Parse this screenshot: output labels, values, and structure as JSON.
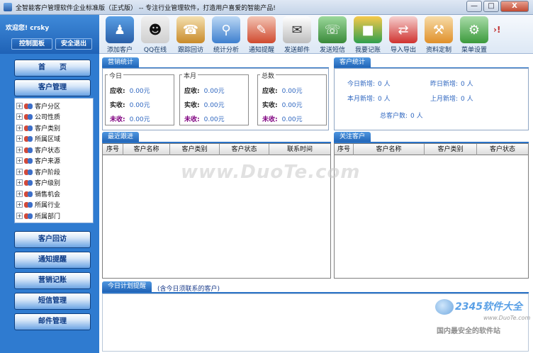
{
  "window": {
    "title": "全智能客户管理软件企业标准版（正式版） -- 专注行业管理软件，打造用户喜爱的智能产品!",
    "buttons": [
      "—",
      "□",
      "X"
    ]
  },
  "user": {
    "welcome": "欢迎您! crsky",
    "control_panel": "控制面板",
    "safe_exit": "安全退出"
  },
  "toolbar": {
    "items": [
      {
        "label": "添加客户",
        "icon": "add-customer-icon",
        "color": "#2a5fa8"
      },
      {
        "label": "QQ在线",
        "icon": "qq-icon",
        "color": "#1b1b1b"
      },
      {
        "label": "跟踪回访",
        "icon": "follow-up-icon",
        "color": "#c98b2a"
      },
      {
        "label": "统计分析",
        "icon": "magnifier-chart-icon",
        "color": "#3d7fcf"
      },
      {
        "label": "通知提醒",
        "icon": "notice-icon",
        "color": "#d04a2f"
      },
      {
        "label": "发送邮件",
        "icon": "mail-icon",
        "color": "#8d8d8d"
      },
      {
        "label": "发送短信",
        "icon": "phone-icon",
        "color": "#3a8a3a"
      },
      {
        "label": "我要记账",
        "icon": "ledger-blocks-icon",
        "color": "#2f9f4e"
      },
      {
        "label": "导入导出",
        "icon": "import-export-icon",
        "color": "#d0322f"
      },
      {
        "label": "资料定制",
        "icon": "customize-tools-icon",
        "color": "#e0902a"
      },
      {
        "label": "菜单设置",
        "icon": "menu-settings-icon",
        "color": "#3c9a3c"
      }
    ]
  },
  "sidebar": {
    "home": "首　　页",
    "customer_mgmt": "客户管理",
    "tree": [
      "客户分区",
      "公司性质",
      "客户类别",
      "所属区域",
      "客户状态",
      "客户来源",
      "客户阶段",
      "客户级别",
      "销售机会",
      "所属行业",
      "所属部门"
    ],
    "bottom": [
      "客户回访",
      "通知提醒",
      "营销记账",
      "短信管理",
      "邮件管理"
    ]
  },
  "sales": {
    "tab": "营销统计",
    "groups": [
      {
        "caption": "今日",
        "rows": [
          {
            "k": "应收:",
            "v": "0.00元"
          },
          {
            "k": "实收:",
            "v": "0.00元"
          },
          {
            "k": "未收:",
            "v": "0.00元"
          }
        ]
      },
      {
        "caption": "本月",
        "rows": [
          {
            "k": "应收:",
            "v": "0.00元"
          },
          {
            "k": "实收:",
            "v": "0.00元"
          },
          {
            "k": "未收:",
            "v": "0.00元"
          }
        ]
      },
      {
        "caption": "总数",
        "rows": [
          {
            "k": "应收:",
            "v": "0.00元"
          },
          {
            "k": "实收:",
            "v": "0.00元"
          },
          {
            "k": "未收:",
            "v": "0.00元"
          }
        ]
      }
    ]
  },
  "customer_stats": {
    "tab": "客户统计",
    "today_new": {
      "k": "今日新增:",
      "v": "0 人"
    },
    "yesterday_new": {
      "k": "昨日新增:",
      "v": "0 人"
    },
    "month_new": {
      "k": "本月新增:",
      "v": "0 人"
    },
    "lastmonth_new": {
      "k": "上月新增:",
      "v": "0 人"
    },
    "total": {
      "k": "总客户数:",
      "v": "0 人"
    }
  },
  "recent": {
    "tab": "最近跟进",
    "columns": [
      "序号",
      "客户名称",
      "客户类别",
      "客户状态",
      "联系时间"
    ]
  },
  "focus": {
    "tab": "关注客户",
    "columns": [
      "序号",
      "客户名称",
      "客户类别",
      "客户状态"
    ]
  },
  "plan": {
    "tab": "今日计划提醒",
    "note": "(含今日须联系的客户)"
  },
  "watermark": {
    "text": "www.DuoTe.com",
    "logo_num": "2345软件大全",
    "logo_url": "www.DuoTe.com",
    "logo_sub": "国内最安全的软件站"
  }
}
